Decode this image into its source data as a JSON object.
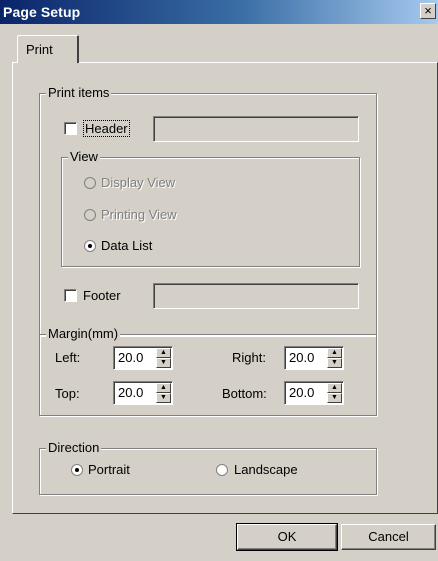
{
  "window": {
    "title": "Page Setup",
    "close_label": "×"
  },
  "tabs": [
    {
      "label": "Print"
    }
  ],
  "print_items": {
    "legend": "Print items",
    "header": {
      "label": "Header",
      "checked": false,
      "text": ""
    },
    "view": {
      "legend": "View",
      "options": [
        {
          "label": "Display View",
          "selected": false,
          "enabled": false
        },
        {
          "label": "Printing View",
          "selected": false,
          "enabled": false
        },
        {
          "label": "Data List",
          "selected": true,
          "enabled": true
        }
      ]
    },
    "footer": {
      "label": "Footer",
      "checked": false,
      "text": ""
    }
  },
  "margin": {
    "legend": "Margin(mm)",
    "left": {
      "label": "Left:",
      "value": "20.0"
    },
    "right": {
      "label": "Right:",
      "value": "20.0"
    },
    "top": {
      "label": "Top:",
      "value": "20.0"
    },
    "bottom": {
      "label": "Bottom:",
      "value": "20.0"
    }
  },
  "direction": {
    "legend": "Direction",
    "options": [
      {
        "label": "Portrait",
        "selected": true
      },
      {
        "label": "Landscape",
        "selected": false
      }
    ]
  },
  "buttons": {
    "ok": "OK",
    "cancel": "Cancel"
  },
  "spin_icons": {
    "up": "▲",
    "down": "▼"
  }
}
